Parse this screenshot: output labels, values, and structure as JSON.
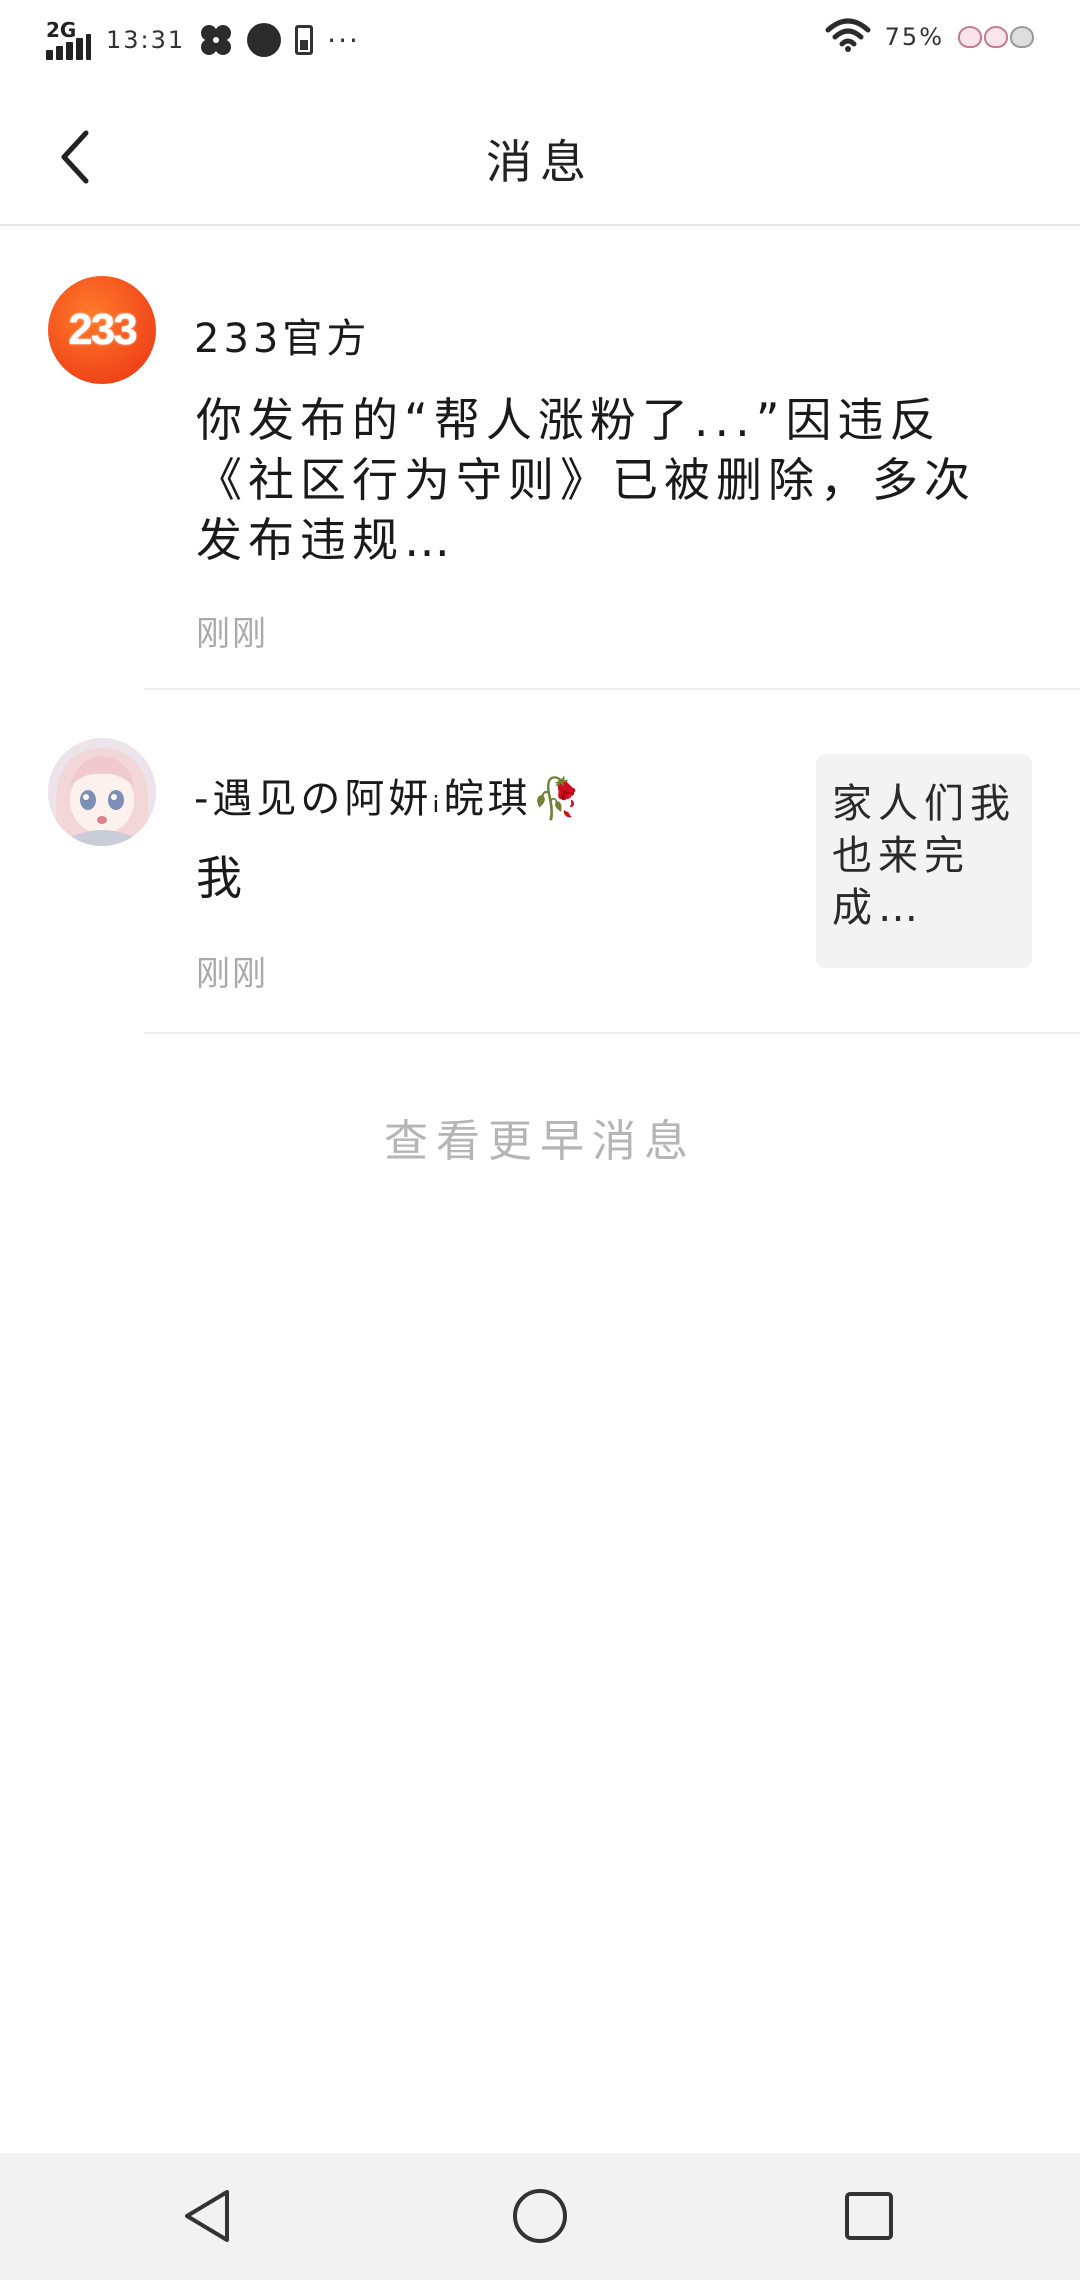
{
  "status_bar": {
    "network": "2G",
    "time": "13:31",
    "more": "···",
    "battery_percent": "75%"
  },
  "header": {
    "title": "消息"
  },
  "messages": [
    {
      "sender": "233官方",
      "avatar_text": "233",
      "text": "你发布的“帮人涨粉了...”因违反《社区行为守则》已被删除，多次发布违规…",
      "time": "刚刚"
    },
    {
      "sender": "-遇见の阿妍ᵢ皖琪🥀",
      "text": "我",
      "time": "刚刚",
      "thumbnail_text": "家人们我也来完成…"
    }
  ],
  "load_more": "查看更早消息",
  "colors": {
    "brand_orange": "#f0471a",
    "divider": "#ececec",
    "muted_text": "#aaaaaa",
    "nav_background": "#f2f2f2"
  },
  "icons": {
    "back": "chevron-left-icon",
    "nav_back": "triangle-back-icon",
    "nav_home": "circle-home-icon",
    "nav_recents": "square-recents-icon"
  }
}
